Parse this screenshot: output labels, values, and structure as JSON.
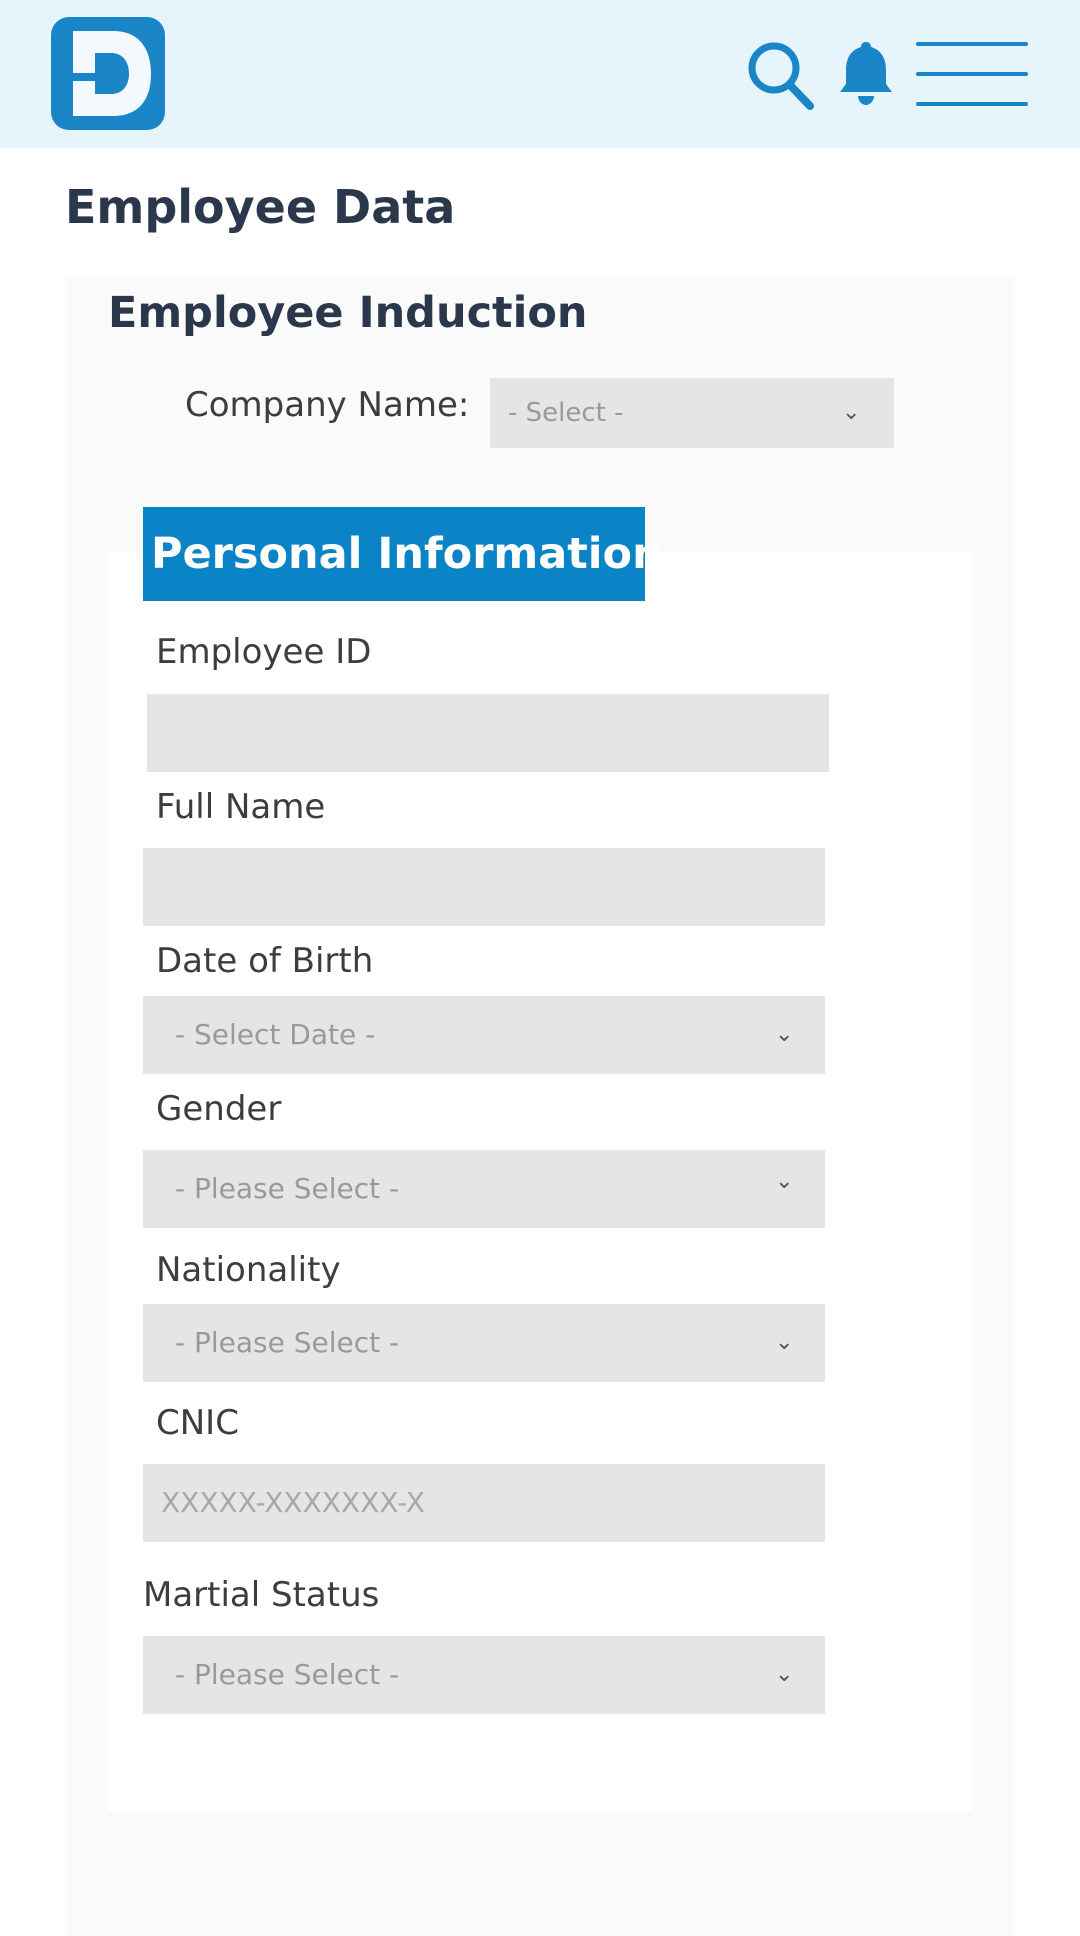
{
  "header": {
    "logo_letter": "D",
    "icons": [
      "search-icon",
      "bell-icon",
      "menu-icon"
    ],
    "accent_color": "#1a86c7",
    "background_color": "#e6f4fb"
  },
  "page_title": "Employee Data",
  "section_title": "Employee Induction",
  "company": {
    "label": "Company Name:",
    "value": "- Select -"
  },
  "tab": {
    "label": "Personal Information",
    "color": "#0a84c6"
  },
  "fields": {
    "employee_id": {
      "label": "Employee ID",
      "value": ""
    },
    "full_name": {
      "label": "Full Name",
      "value": ""
    },
    "dob": {
      "label": "Date of Birth",
      "value": "- Select Date -"
    },
    "gender": {
      "label": "Gender",
      "value": "- Please Select -"
    },
    "nationality": {
      "label": "Nationality",
      "value": "- Please Select -"
    },
    "cnic": {
      "label": "CNIC",
      "placeholder": "XXXXX-XXXXXXX-X"
    },
    "marital_status": {
      "label": "Martial Status",
      "value": "- Please Select -"
    }
  },
  "chevron_glyph": "⌄"
}
